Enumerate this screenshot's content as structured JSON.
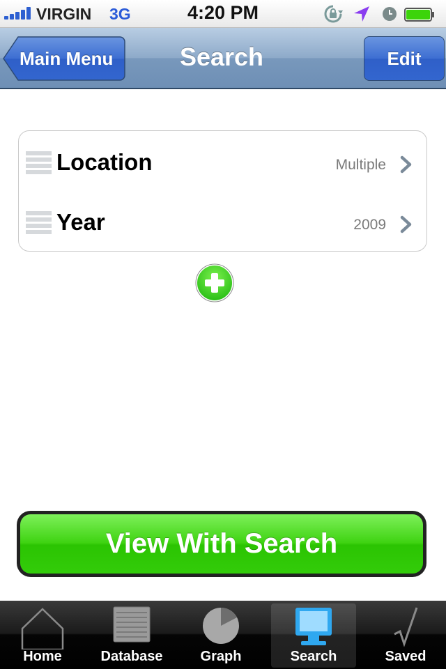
{
  "status_bar": {
    "carrier": "VIRGIN",
    "network": "3G",
    "time": "4:20 PM"
  },
  "nav": {
    "back_label": "Main Menu",
    "title": "Search",
    "edit_label": "Edit"
  },
  "filters": [
    {
      "label": "Location",
      "value": "Multiple"
    },
    {
      "label": "Year",
      "value": "2009"
    }
  ],
  "view_button_label": "View With Search",
  "tabs": [
    {
      "label": "Home",
      "icon": "home-icon",
      "selected": false
    },
    {
      "label": "Database",
      "icon": "database-icon",
      "selected": false
    },
    {
      "label": "Graph",
      "icon": "graph-icon",
      "selected": false
    },
    {
      "label": "Search",
      "icon": "monitor-icon",
      "selected": true
    },
    {
      "label": "Saved",
      "icon": "checkmark-icon",
      "selected": false
    }
  ],
  "colors": {
    "nav_bar": "#8eaac9",
    "edit_button": "#3366cf",
    "view_button": "#33cc0a",
    "add_button": "#2fc21a",
    "network_text": "#2a5ad8",
    "location_arrow": "#8a3df0",
    "battery": "#3cd40a"
  }
}
